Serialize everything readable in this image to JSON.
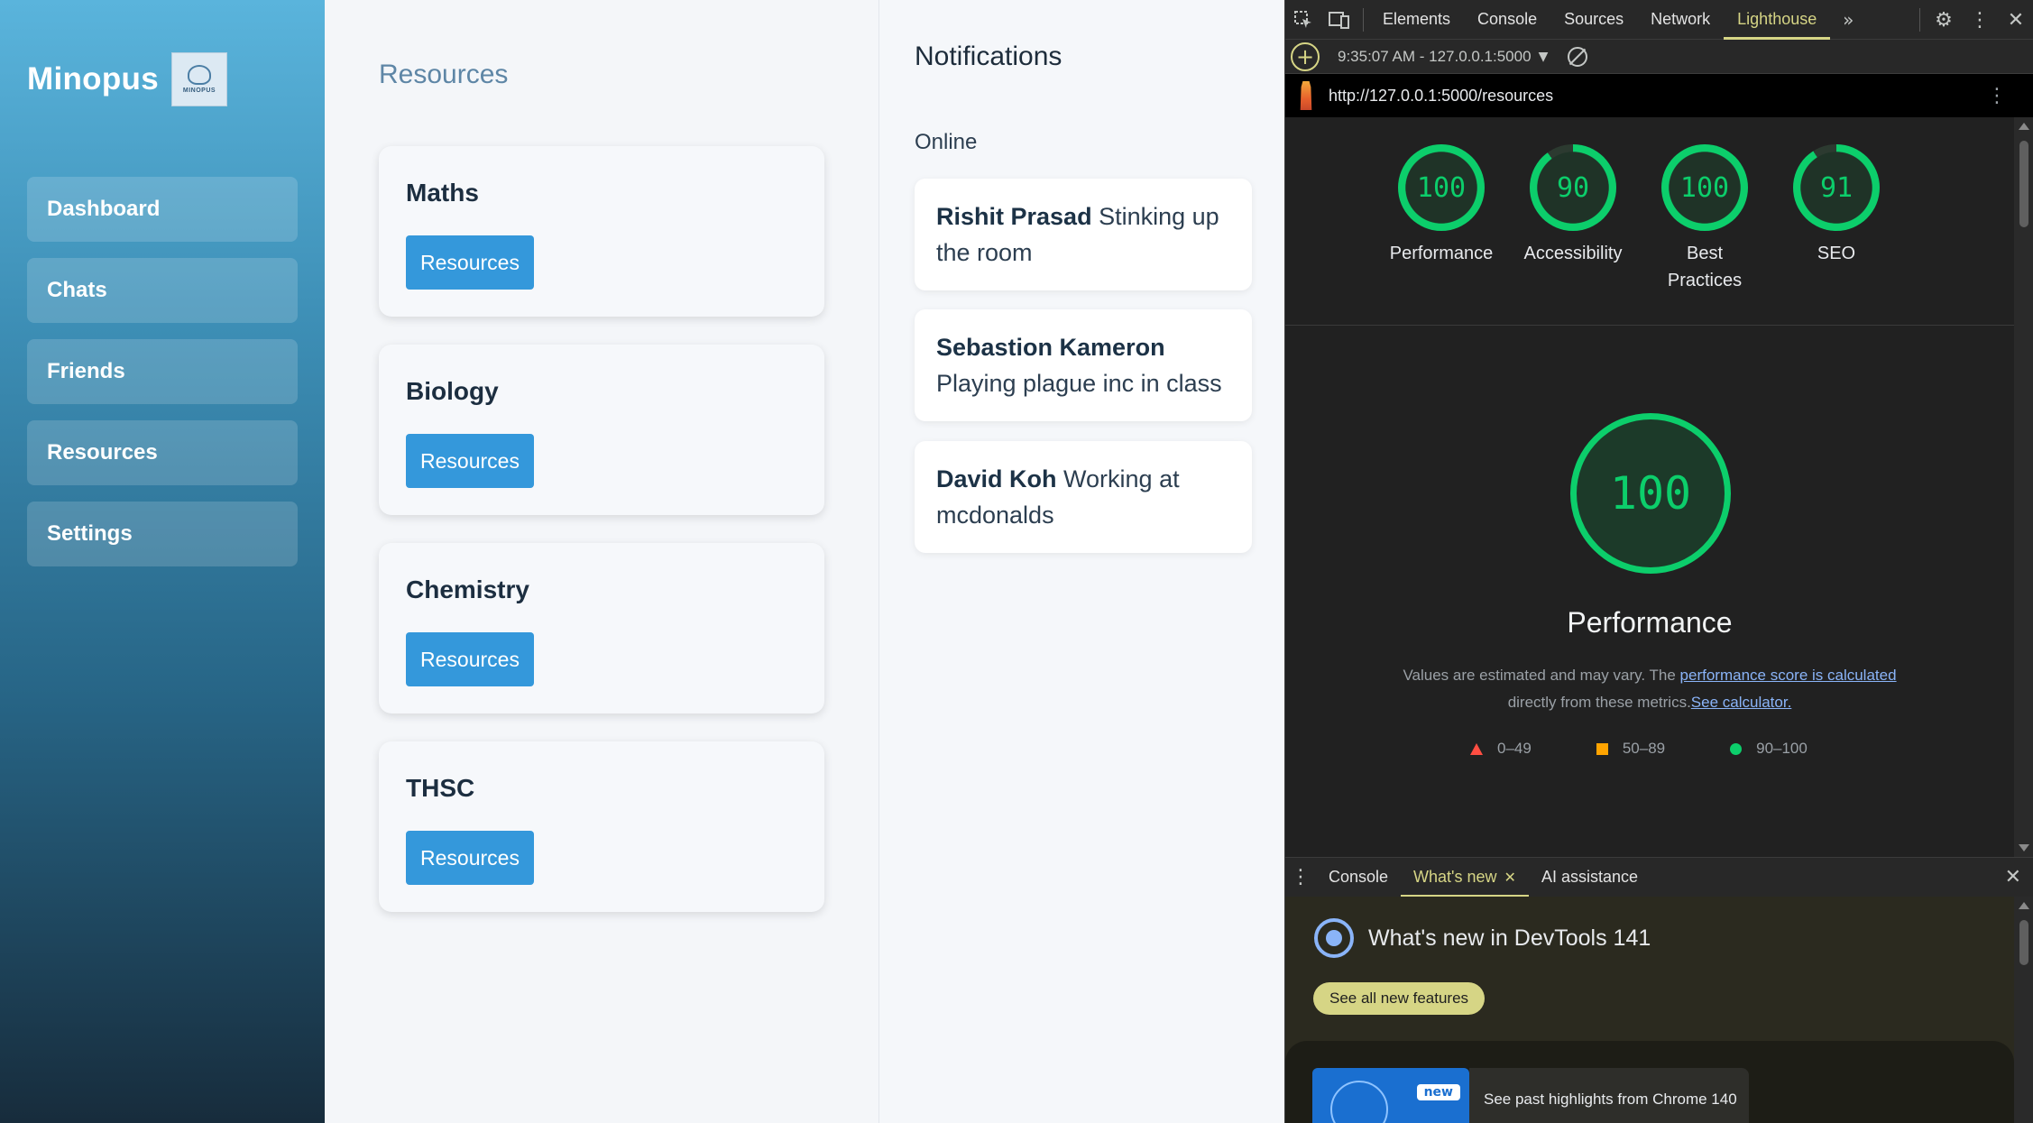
{
  "sidebar": {
    "brand": "Minopus",
    "logo_text": "MINOPUS",
    "items": [
      {
        "label": "Dashboard"
      },
      {
        "label": "Chats"
      },
      {
        "label": "Friends"
      },
      {
        "label": "Resources"
      },
      {
        "label": "Settings"
      }
    ]
  },
  "resources": {
    "title": "Resources",
    "cards": [
      {
        "subject": "Maths",
        "button": "Resources"
      },
      {
        "subject": "Biology",
        "button": "Resources"
      },
      {
        "subject": "Chemistry",
        "button": "Resources"
      },
      {
        "subject": "THSC",
        "button": "Resources"
      }
    ]
  },
  "notifications": {
    "title": "Notifications",
    "online_label": "Online",
    "items": [
      {
        "name": "Rishit Prasad",
        "status": "Stinking up the room"
      },
      {
        "name": "Sebastion Kameron",
        "status": "Playing plague inc in class"
      },
      {
        "name": "David Koh",
        "status": "Working at mcdonalds"
      }
    ]
  },
  "devtools": {
    "tabs": [
      "Elements",
      "Console",
      "Sources",
      "Network",
      "Lighthouse"
    ],
    "active_tab": "Lighthouse",
    "more_tabs_icon": "double-chevron-right",
    "run_label": "9:35:07 AM - 127.0.0.1:5000",
    "url": "http://127.0.0.1:5000/resources",
    "scores": [
      {
        "label": "Performance",
        "value": "100"
      },
      {
        "label": "Accessibility",
        "value": "90"
      },
      {
        "label": "Best Practices",
        "value": "100"
      },
      {
        "label": "SEO",
        "value": "91"
      }
    ],
    "main_score": {
      "value": "100",
      "title": "Performance",
      "desc_prefix": "Values are estimated and may vary. The ",
      "desc_link1": "performance score is calculated",
      "desc_middle": " directly from these metrics.",
      "desc_link2": "See calculator."
    },
    "legend": [
      "0–49",
      "50–89",
      "90–100"
    ],
    "drawer": {
      "tabs": [
        "Console",
        "What's new",
        "AI assistance"
      ],
      "active_tab": "What's new",
      "whats_new_title": "What's new in DevTools 141",
      "see_all_button": "See all new features",
      "badge": "new",
      "past_highlights": "See past highlights from Chrome 140"
    },
    "colors": {
      "pass": "#0cce6b",
      "average": "#ffa400",
      "fail": "#ff4e42",
      "accent": "#d6d585"
    }
  }
}
